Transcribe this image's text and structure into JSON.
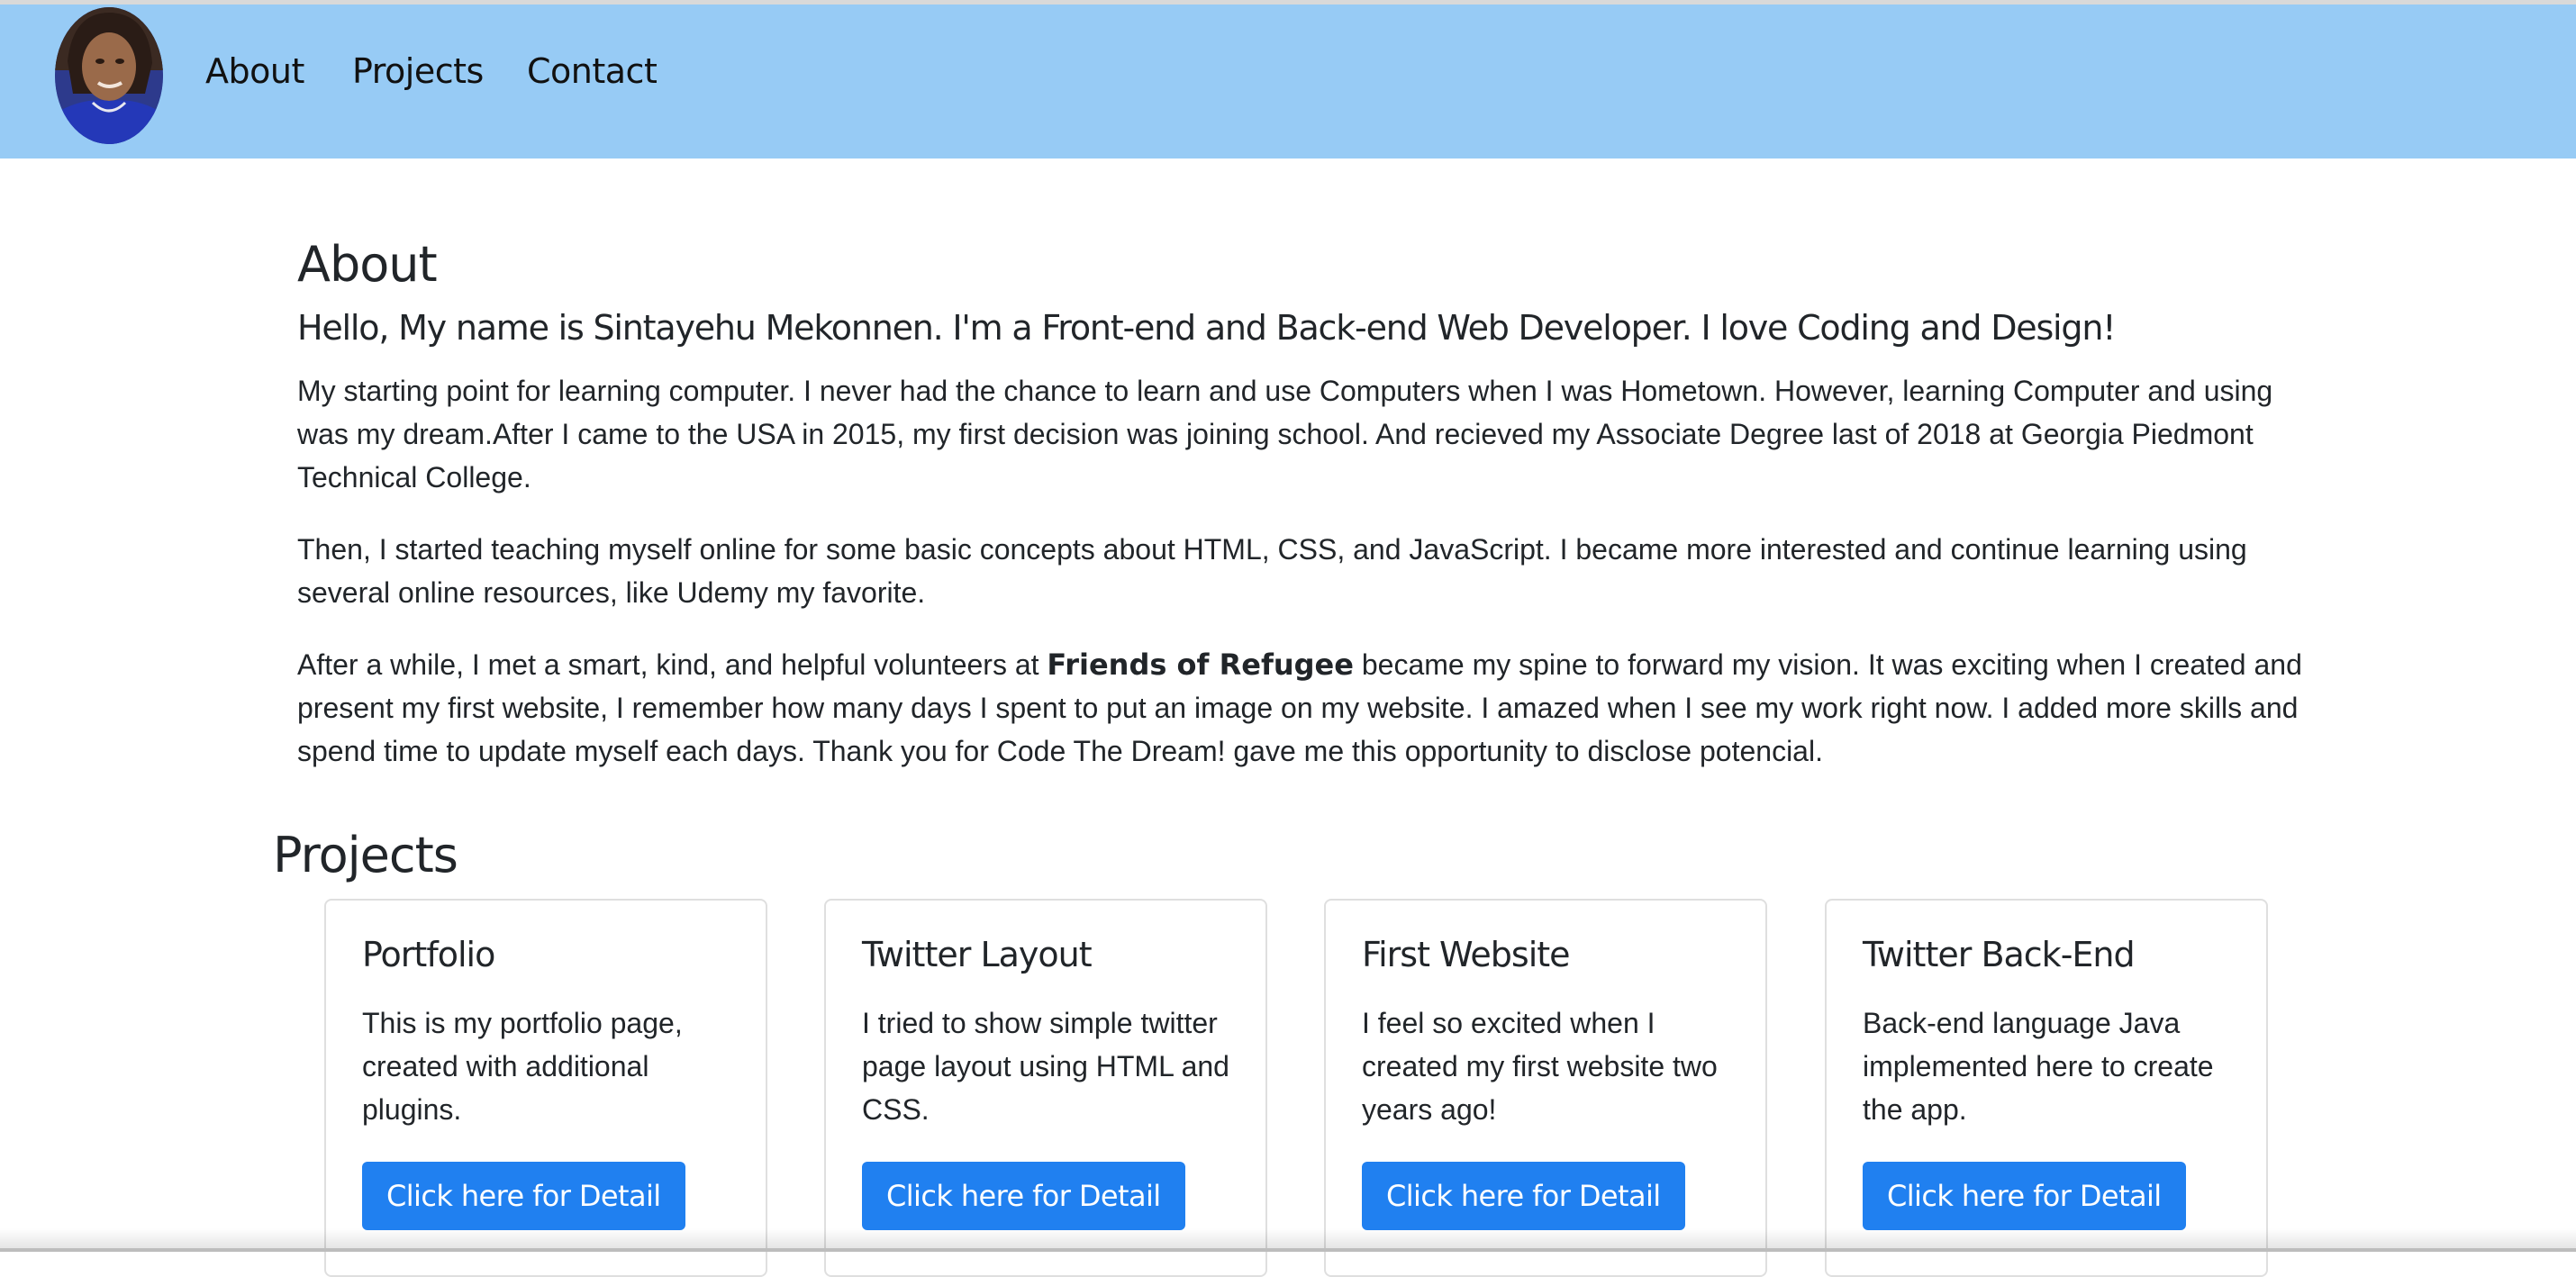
{
  "nav": {
    "avatar_alt": "Profile photo",
    "links": [
      "About",
      "Projects",
      "Contact"
    ]
  },
  "about": {
    "heading": "About",
    "intro": "Hello, My name is Sintayehu Mekonnen. I'm a Front-end and Back-end Web Developer. I love Coding and Design!",
    "p1": "My starting point for learning computer. I never had the chance to learn and use Computers when I was Hometown. However, learning Computer and using was my dream.After I came to the USA in 2015, my first decision was joining school. And recieved my Associate Degree last of 2018 at Georgia Piedmont Technical College.",
    "p2": "Then, I started teaching myself online for some basic concepts about HTML, CSS, and JavaScript. I became more interested and continue learning using several online resources, like Udemy my favorite.",
    "p3_before": "After a while, I met a smart, kind, and helpful volunteers at ",
    "p3_bold": "Friends of Refugee",
    "p3_after": " became my spine to forward my vision. It was exciting when I created and present my first website, I remember how many days I spent to put an image on my website. I amazed when I see my work right now. I added more skills and spend time to update myself each days. Thank you for Code The Dream! gave me this opportunity to disclose potencial."
  },
  "projects": {
    "heading": "Projects",
    "cards": [
      {
        "title": "Portfolio",
        "text": "This is my portfolio page, created with additional plugins.",
        "button": "Click here for Detail"
      },
      {
        "title": "Twitter Layout",
        "text": "I tried to show simple twitter page layout using HTML and CSS.",
        "button": "Click here for Detail"
      },
      {
        "title": "First Website",
        "text": "I feel so excited when I created my first website two years ago!",
        "button": "Click here for Detail"
      },
      {
        "title": "Twitter Back-End",
        "text": "Back-end language Java implemented here to create the app.",
        "button": "Click here for Detail"
      }
    ]
  },
  "colors": {
    "navbar": "#97cbf5",
    "button": "#2080f0"
  }
}
